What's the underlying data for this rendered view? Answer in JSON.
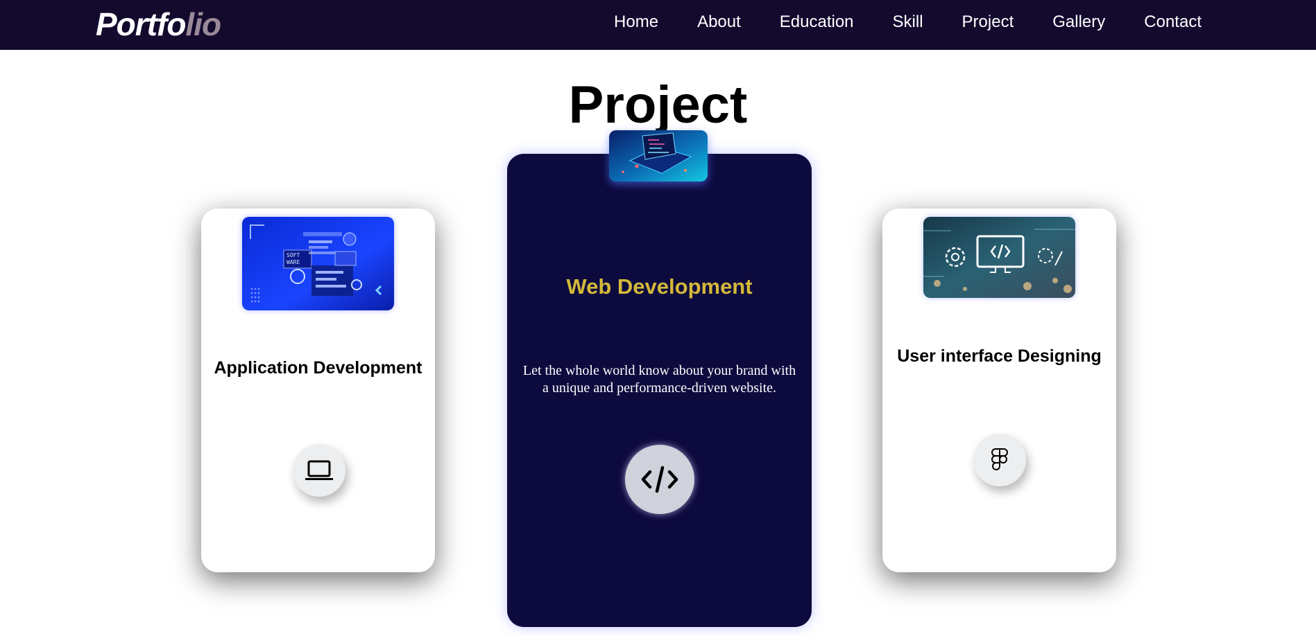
{
  "nav": {
    "logo_part1": "Portfo",
    "logo_part2": "lio",
    "links": [
      "Home",
      "About",
      "Education",
      "Skill",
      "Project",
      "Gallery",
      "Contact"
    ]
  },
  "section": {
    "title": "Project"
  },
  "cards": [
    {
      "title": "Application Development",
      "icon": "laptop-icon",
      "image": "software-coding-image"
    },
    {
      "title": "Web Development",
      "description": "Let the whole world know about your brand with a unique and performance-driven website.",
      "icon": "code-icon",
      "image": "laptop-code-image",
      "title_color": "#d4b93a"
    },
    {
      "title": "User interface Designing",
      "icon": "figma-icon",
      "image": "ui-code-monitor-image"
    }
  ],
  "colors": {
    "nav_bg": "#130a2e",
    "center_card_bg": "#0d0a3e",
    "logo_accent": "#9a8a98"
  }
}
